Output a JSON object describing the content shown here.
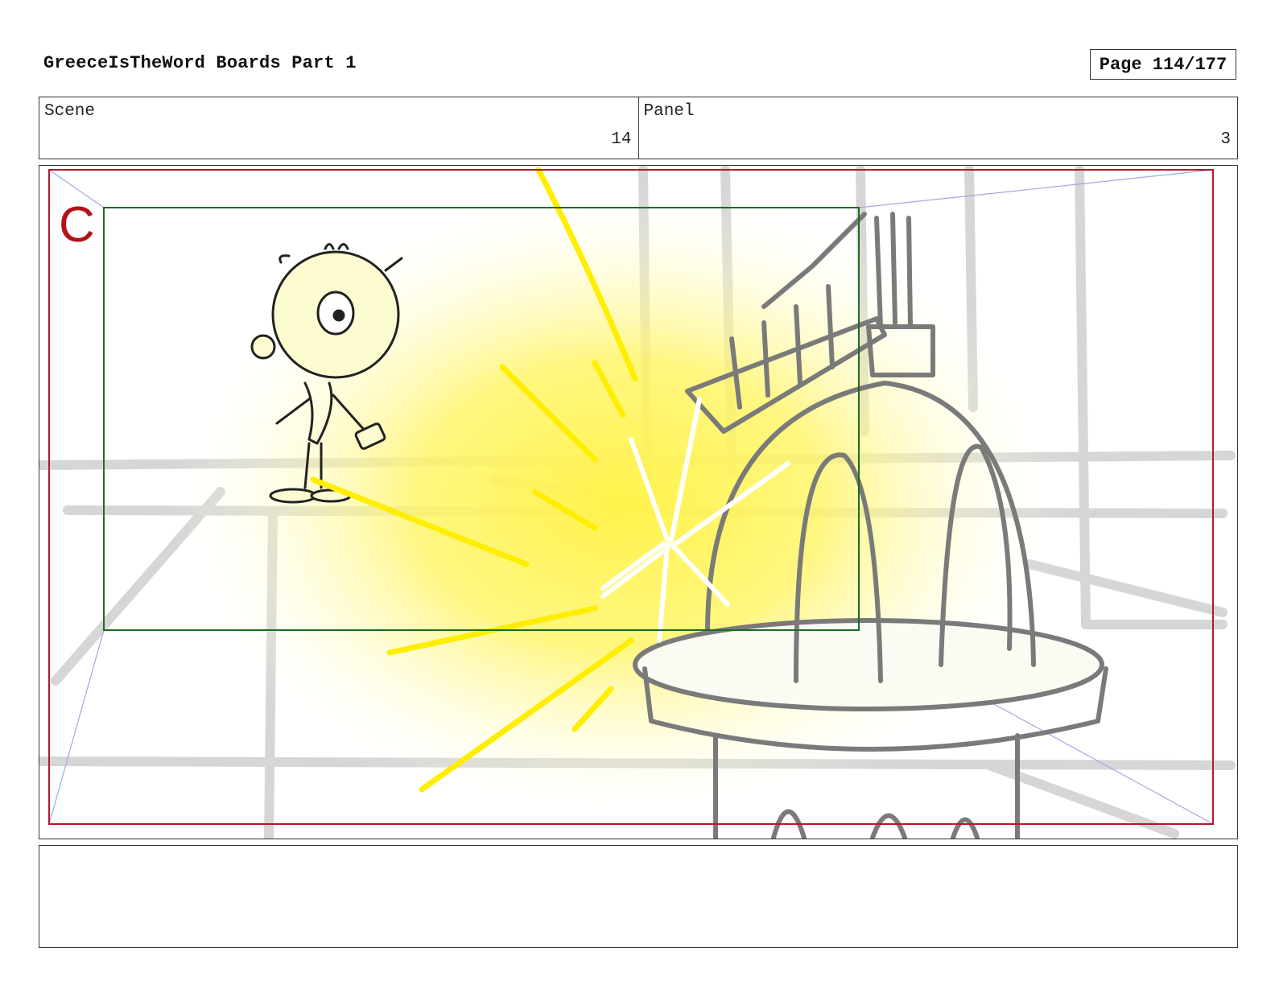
{
  "header": {
    "title": "GreeceIsTheWord Boards Part 1",
    "page_label": "Page 114/177"
  },
  "meta": {
    "scene_label": "Scene",
    "scene_value": "14",
    "panel_label": "Panel",
    "panel_value": "3"
  },
  "panel": {
    "camera_marker": "C",
    "colors": {
      "safe_frame": "#b11a2a",
      "camera_frame": "#1f6b22",
      "camera_marker": "#b51218",
      "flash_glow": "#fff34a",
      "flash_rays": "#ffee00",
      "perspective_lines": "#9a9ad8",
      "background_sketch": "#cfcfcf",
      "prop_sketch": "#7a7a7a",
      "character_ink": "#222222"
    },
    "icons": [
      "character-sketch",
      "pedestal-sketch",
      "light-burst"
    ]
  },
  "notes": {
    "text": ""
  }
}
